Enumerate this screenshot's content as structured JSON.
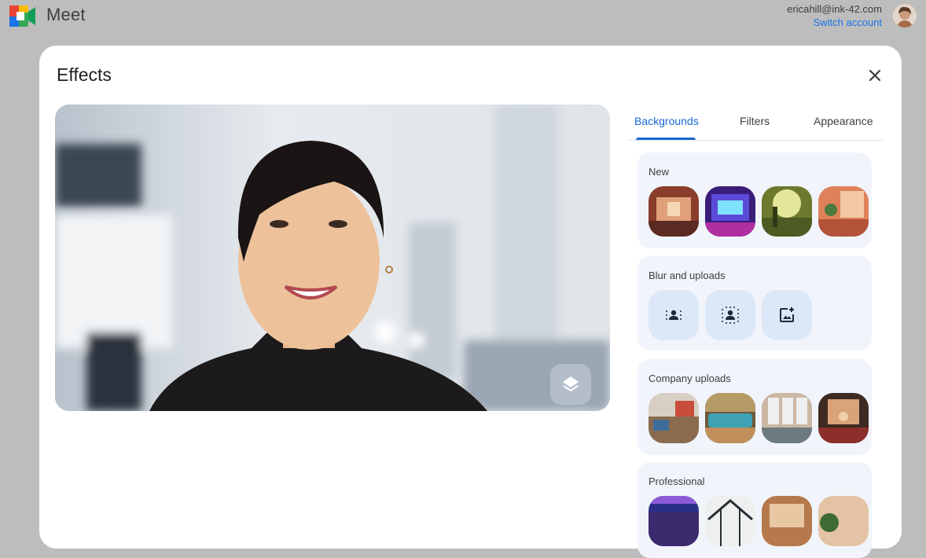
{
  "app": {
    "title": "Meet"
  },
  "account": {
    "email": "ericahill@ink-42.com",
    "switch_label": "Switch account"
  },
  "dialog": {
    "title": "Effects"
  },
  "tabs": [
    {
      "label": "Backgrounds",
      "active": true
    },
    {
      "label": "Filters",
      "active": false
    },
    {
      "label": "Appearance",
      "active": false
    }
  ],
  "sections": [
    {
      "label": "New",
      "items": [
        "warm-room-thumb",
        "neon-arcade-thumb",
        "forest-light-thumb",
        "sunset-lounge-thumb"
      ]
    },
    {
      "label": "Blur and uploads",
      "items": [
        "slight-blur-icon",
        "blur-icon",
        "add-image-icon"
      ]
    },
    {
      "label": "Company uploads",
      "items": [
        "office-lounge-thumb",
        "cafe-counter-thumb",
        "window-office-thumb",
        "meeting-nook-thumb"
      ]
    },
    {
      "label": "Professional",
      "items": [
        "stage-thumb",
        "greenhouse-thumb",
        "wood-office-thumb",
        "plant-room-thumb"
      ]
    }
  ],
  "colors": {
    "accent": "#1a67d2",
    "section_bg": "#f1f5fb",
    "icon_tile": "#dce7f8"
  }
}
